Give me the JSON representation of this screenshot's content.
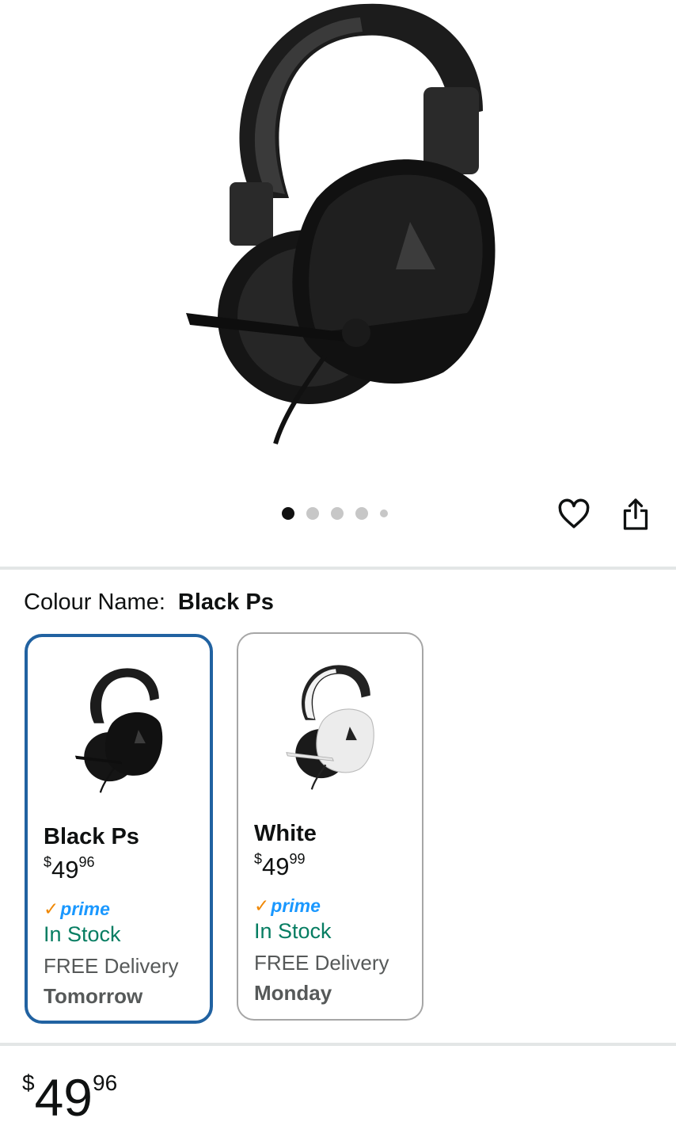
{
  "gallery": {
    "image_alt": "Black over-ear gaming headset with boom microphone",
    "dot_count": 5,
    "active_dot": 1
  },
  "actions": {
    "wishlist_icon": "heart-icon",
    "share_icon": "share-icon"
  },
  "colour": {
    "label": "Colour Name:",
    "selected": "Black Ps"
  },
  "variants": [
    {
      "name": "Black Ps",
      "currency": "$",
      "price_whole": "49",
      "price_fraction": "96",
      "prime": "prime",
      "stock": "In Stock",
      "delivery": "FREE Delivery",
      "when": "Tomorrow",
      "selected": true
    },
    {
      "name": "White",
      "currency": "$",
      "price_whole": "49",
      "price_fraction": "99",
      "prime": "prime",
      "stock": "In Stock",
      "delivery": "FREE Delivery",
      "when": "Monday",
      "selected": false
    }
  ],
  "price": {
    "currency": "$",
    "whole": "49",
    "fraction": "96"
  },
  "colors": {
    "selected_border": "#2162a1",
    "stock_green": "#067d62",
    "prime_blue": "#1a98ff",
    "prime_check": "#f08804"
  }
}
